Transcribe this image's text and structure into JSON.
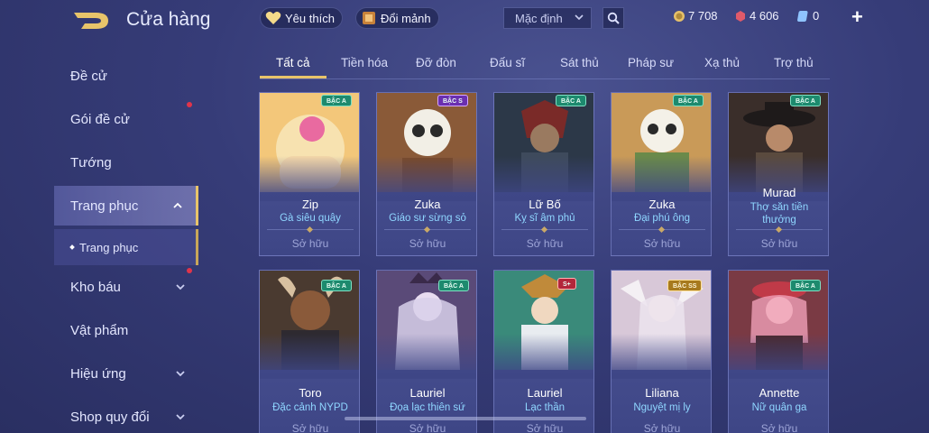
{
  "header": {
    "title": "Cửa hàng",
    "favorites_label": "Yêu thích",
    "exchange_label": "Đổi mảnh",
    "sort_select": "Mặc định",
    "currencies": [
      {
        "name": "coin-icon",
        "value": "7 708",
        "color": "#e6c06a"
      },
      {
        "name": "voucher-icon",
        "value": "4 606",
        "color": "#e05a6a"
      },
      {
        "name": "ticket-icon",
        "value": "0",
        "color": "#8fc4ff"
      }
    ],
    "plus": "+"
  },
  "sidebar": {
    "items": [
      {
        "label": "Đề cử"
      },
      {
        "label": "Gói đề cử"
      },
      {
        "label": "Tướng"
      },
      {
        "label": "Trang phục"
      },
      {
        "label": "Kho báu"
      },
      {
        "label": "Vật phẩm"
      },
      {
        "label": "Hiệu ứng"
      },
      {
        "label": "Shop quy đổi"
      }
    ],
    "sub_item": "Trang phục"
  },
  "tabs": [
    "Tất cả",
    "Tiền hóa",
    "Đỡ đòn",
    "Đấu sĩ",
    "Sát thủ",
    "Pháp sư",
    "Xạ thủ",
    "Trợ thủ"
  ],
  "cards": [
    {
      "badge": "BẬC A",
      "hero": "Zip",
      "skin": "Gà siêu quậy",
      "status": "Sở hữu"
    },
    {
      "badge": "BẬC S",
      "hero": "Zuka",
      "skin": "Giáo sư sừng sỏ",
      "status": "Sở hữu"
    },
    {
      "badge": "BẬC A",
      "hero": "Lữ Bố",
      "skin": "Kỵ sĩ âm phủ",
      "status": "Sở hữu"
    },
    {
      "badge": "BẬC A",
      "hero": "Zuka",
      "skin": "Đại phú ông",
      "status": "Sở hữu"
    },
    {
      "badge": "BẬC A",
      "hero": "Murad",
      "skin": "Thợ săn tiền thưởng",
      "status": "Sở hữu"
    },
    {
      "badge": "BẬC A",
      "hero": "Toro",
      "skin": "Đặc cảnh NYPD",
      "status": "Sở hữu"
    },
    {
      "badge": "BẬC A",
      "hero": "Lauriel",
      "skin": "Đọa lạc thiên sứ",
      "status": "Sở hữu"
    },
    {
      "badge": "S+",
      "hero": "Lauriel",
      "skin": "Lạc thần",
      "status": "Sở hữu"
    },
    {
      "badge": "BẬC SS",
      "hero": "Liliana",
      "skin": "Nguyệt mị ly",
      "status": "Sở hữu"
    },
    {
      "badge": "BẬC A",
      "hero": "Annette",
      "skin": "Nữ quân ga",
      "status": "Sở hữu"
    }
  ],
  "colors": {
    "accent": "#e8c46a",
    "skin_text": "#8fd6ff",
    "badge_a": "#1d8a6e",
    "badge_s": "#6a2fb0",
    "badge_ss": "#a77a1e",
    "badge_sp": "#b3263a"
  }
}
